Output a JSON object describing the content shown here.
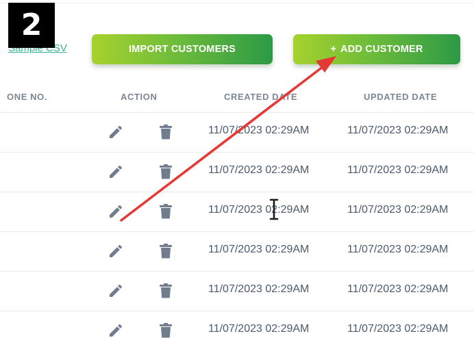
{
  "step_badge": "2",
  "toolbar": {
    "sample_link": "Sample CSV",
    "import_label": "IMPORT CUSTOMERS",
    "add_plus": "+",
    "add_label": "ADD CUSTOMER"
  },
  "table": {
    "headers": {
      "phone": "ONE NO.",
      "action": "ACTION",
      "created": "CREATED DATE",
      "updated": "UPDATED DATE"
    },
    "rows": [
      {
        "created": "11/07/2023 02:29AM",
        "updated": "11/07/2023 02:29AM"
      },
      {
        "created": "11/07/2023 02:29AM",
        "updated": "11/07/2023 02:29AM"
      },
      {
        "created": "11/07/2023 02:29AM",
        "updated": "11/07/2023 02:29AM"
      },
      {
        "created": "11/07/2023 02:29AM",
        "updated": "11/07/2023 02:29AM"
      },
      {
        "created": "11/07/2023 02:29AM",
        "updated": "11/07/2023 02:29AM"
      },
      {
        "created": "11/07/2023 02:29AM",
        "updated": "11/07/2023 02:29AM"
      }
    ]
  },
  "icons": {
    "edit": "pencil-icon",
    "delete": "trash-icon",
    "cursor": "text-cursor-icon",
    "annotation": "red-arrow"
  },
  "colors": {
    "button_start": "#a7d22e",
    "button_end": "#2c9a46",
    "header_text": "#7c8794",
    "cell_text": "#4c5a6b",
    "icon": "#6f7d8e",
    "arrow": "#e53935",
    "link": "#39b08c"
  }
}
